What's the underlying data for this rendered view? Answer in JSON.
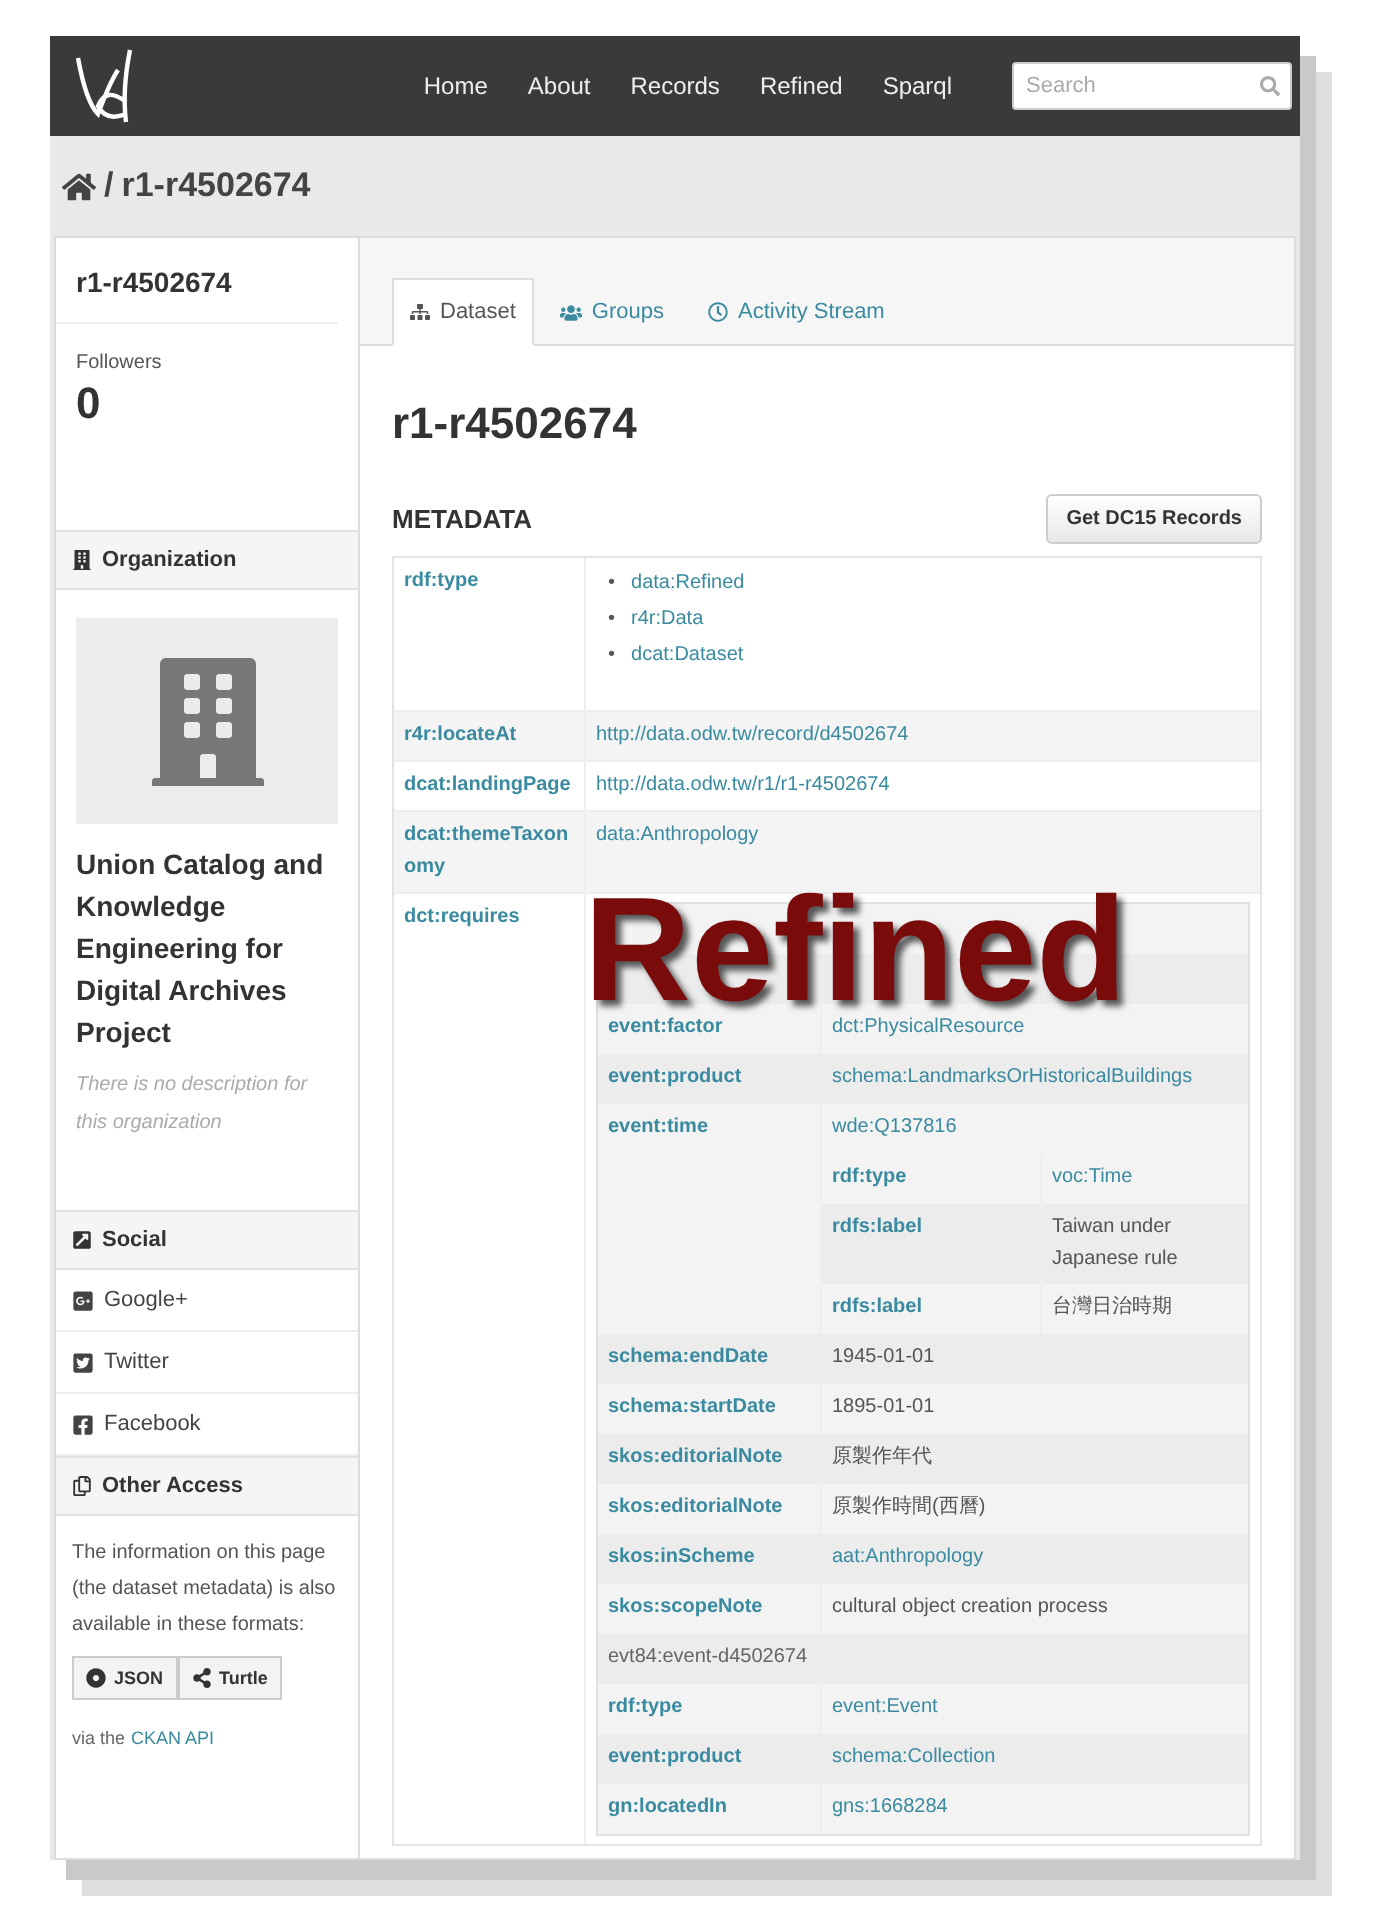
{
  "navbar": {
    "links": [
      {
        "label": "Home"
      },
      {
        "label": "About"
      },
      {
        "label": "Records"
      },
      {
        "label": "Refined"
      },
      {
        "label": "Sparql"
      }
    ],
    "search": {
      "placeholder": "Search"
    }
  },
  "breadcrumb": {
    "separator": "/",
    "current": "r1-r4502674"
  },
  "sidebar": {
    "title": "r1-r4502674",
    "followers_label": "Followers",
    "followers_count": "0",
    "organization": {
      "heading": "Organization",
      "name": "Union Catalog and Knowledge Engineering for Digital Archives Project",
      "description": "There is no description for this organization"
    },
    "social": {
      "heading": "Social",
      "items": [
        {
          "label": "Google+",
          "kind": "googleplus"
        },
        {
          "label": "Twitter",
          "kind": "twitter"
        },
        {
          "label": "Facebook",
          "kind": "facebook"
        }
      ]
    },
    "other_access": {
      "heading": "Other Access",
      "text": "The information on this page (the dataset metadata) is also available in these formats:",
      "formats": [
        {
          "label": "JSON",
          "kind": "json"
        },
        {
          "label": "Turtle",
          "kind": "turtle"
        }
      ],
      "note_prefix": "via the",
      "note_link": "CKAN API"
    }
  },
  "main": {
    "tabs": [
      {
        "label": "Dataset",
        "kind": "dataset",
        "selected": true
      },
      {
        "label": "Groups",
        "kind": "groups",
        "selected": false
      },
      {
        "label": "Activity Stream",
        "kind": "activity",
        "selected": false
      }
    ],
    "title": "r1-r4502674",
    "metadata_heading": "METADATA",
    "records_button": "Get DC15 Records",
    "rows": [
      {
        "kind": "list",
        "key": "rdf:type",
        "bullet": "•",
        "values": [
          "data:Refined",
          "r4r:Data",
          "dcat:Dataset"
        ]
      },
      {
        "kind": "value",
        "key": "r4r:locateAt",
        "value": "http://data.odw.tw/record/d4502674",
        "link": true
      },
      {
        "kind": "value",
        "key": "dcat:landingPage",
        "value": "http://data.odw.tw/r1/r1-r4502674",
        "link": true
      },
      {
        "kind": "value",
        "key": "dcat:themeTaxonomy",
        "value": "data:Anthropology",
        "link": true
      },
      {
        "kind": "nested",
        "key": "dct:requires",
        "rows": [
          {
            "kind": "blank"
          },
          {
            "kind": "blank"
          },
          {
            "kind": "value",
            "key": "event:factor",
            "value": "dct:PhysicalResource",
            "link": true
          },
          {
            "kind": "value",
            "key": "event:product",
            "value": "schema:LandmarksOrHistoricalBuildings",
            "link": true
          },
          {
            "kind": "value",
            "key": "event:time",
            "value": "wde:Q137816",
            "link": true,
            "rows": [
              {
                "kind": "value",
                "key": "rdf:type",
                "value": "voc:Time",
                "link": true
              },
              {
                "kind": "value",
                "key": "rdfs:label",
                "value": "Taiwan under Japanese rule",
                "link": false
              },
              {
                "kind": "value",
                "key": "rdfs:label",
                "value": "台灣日治時期",
                "link": false
              }
            ]
          },
          {
            "kind": "value",
            "key": "schema:endDate",
            "value": "1945-01-01",
            "link": false
          },
          {
            "kind": "value",
            "key": "schema:startDate",
            "value": "1895-01-01",
            "link": false
          },
          {
            "kind": "value",
            "key": "skos:editorialNote",
            "value": "原製作年代",
            "link": false
          },
          {
            "kind": "value",
            "key": "skos:editorialNote",
            "value": "原製作時間(西曆)",
            "link": false
          },
          {
            "kind": "value",
            "key": "skos:inScheme",
            "value": "aat:Anthropology",
            "link": true
          },
          {
            "kind": "value",
            "key": "skos:scopeNote",
            "value": "cultural object creation process",
            "link": false
          },
          {
            "kind": "subject",
            "value": "evt84:event-d4502674"
          },
          {
            "kind": "value",
            "key": "rdf:type",
            "value": "event:Event",
            "link": true
          },
          {
            "kind": "value",
            "key": "event:product",
            "value": "schema:Collection",
            "link": true
          },
          {
            "kind": "value",
            "key": "gn:locatedIn",
            "value": "gns:1668284",
            "link": true
          }
        ]
      }
    ]
  },
  "overlay": {
    "label": "Refined"
  }
}
